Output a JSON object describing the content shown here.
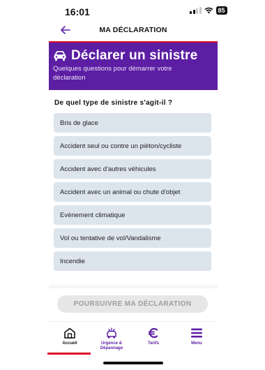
{
  "status_bar": {
    "time": "16:01",
    "battery": "85"
  },
  "header": {
    "title": "MA DÉCLARATION"
  },
  "banner": {
    "title": "Déclarer un sinistre",
    "subtitle": "Quelques questions pour démarrer votre déclaration",
    "icon": "car-crash-icon"
  },
  "question": "De quel type de sinistre s'agit-il ?",
  "options": [
    {
      "label": "Bris de glace"
    },
    {
      "label": "Accident seul ou contre un piéton/cycliste"
    },
    {
      "label": "Accident avec d'autres véhicules"
    },
    {
      "label": "Accident avec un animal ou chute d'objet"
    },
    {
      "label": "Evènement climatique"
    },
    {
      "label": "Vol ou tentative de vol/Vandalisme"
    },
    {
      "label": "Incendie"
    }
  ],
  "continue_button": {
    "label": "POURSUIVRE MA DÉCLARATION",
    "enabled": false
  },
  "bottom_nav": {
    "items": [
      {
        "label": "Accueil",
        "icon": "home-icon",
        "active": true
      },
      {
        "label": "Urgence & Dépannage",
        "icon": "tow-truck-icon",
        "active": false
      },
      {
        "label": "Tarifs",
        "icon": "euro-icon",
        "active": false
      },
      {
        "label": "Menu",
        "icon": "menu-icon",
        "active": false
      }
    ]
  },
  "colors": {
    "brand_purple": "#5c1ea3",
    "accent_red": "#e0102a",
    "option_bg": "#dce4ec"
  }
}
